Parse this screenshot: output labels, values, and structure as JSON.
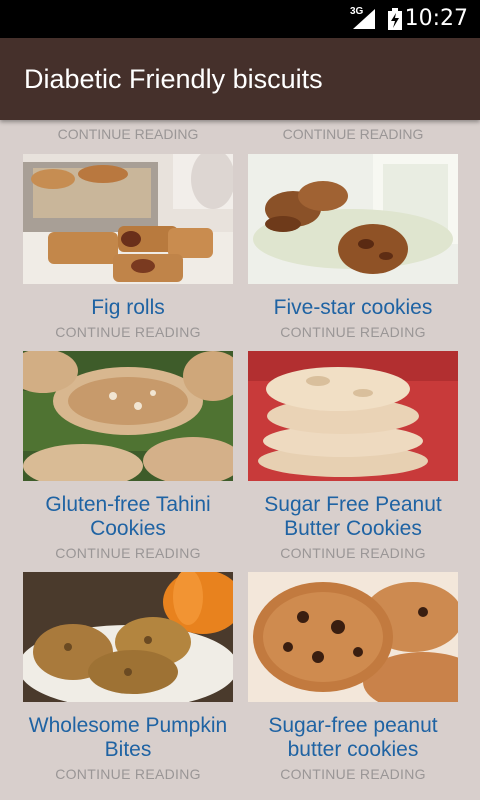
{
  "status_bar": {
    "network": "3G",
    "time": "10:27"
  },
  "app_bar": {
    "title": "Diabetic Friendly biscuits"
  },
  "continue_label": "CONTINUE READING",
  "recipes": [
    {
      "title": "Fig rolls",
      "image": "fig-rolls-photo"
    },
    {
      "title": "Five-star cookies",
      "image": "five-star-cookies-photo"
    },
    {
      "title": "Gluten-free Tahini Cookies",
      "image": "tahini-cookies-photo"
    },
    {
      "title": "Sugar Free Peanut Butter Cookies",
      "image": "peanut-butter-cookies-photo"
    },
    {
      "title": "Wholesome Pumpkin Bites",
      "image": "pumpkin-bites-photo"
    },
    {
      "title": "Sugar-free peanut butter cookies",
      "image": "sugar-free-peanut-cookies-photo"
    }
  ],
  "colors": {
    "app_bar": "#45302b",
    "background": "#d8cfcc",
    "title_link": "#1f63a3",
    "secondary_text": "#9a9696"
  }
}
